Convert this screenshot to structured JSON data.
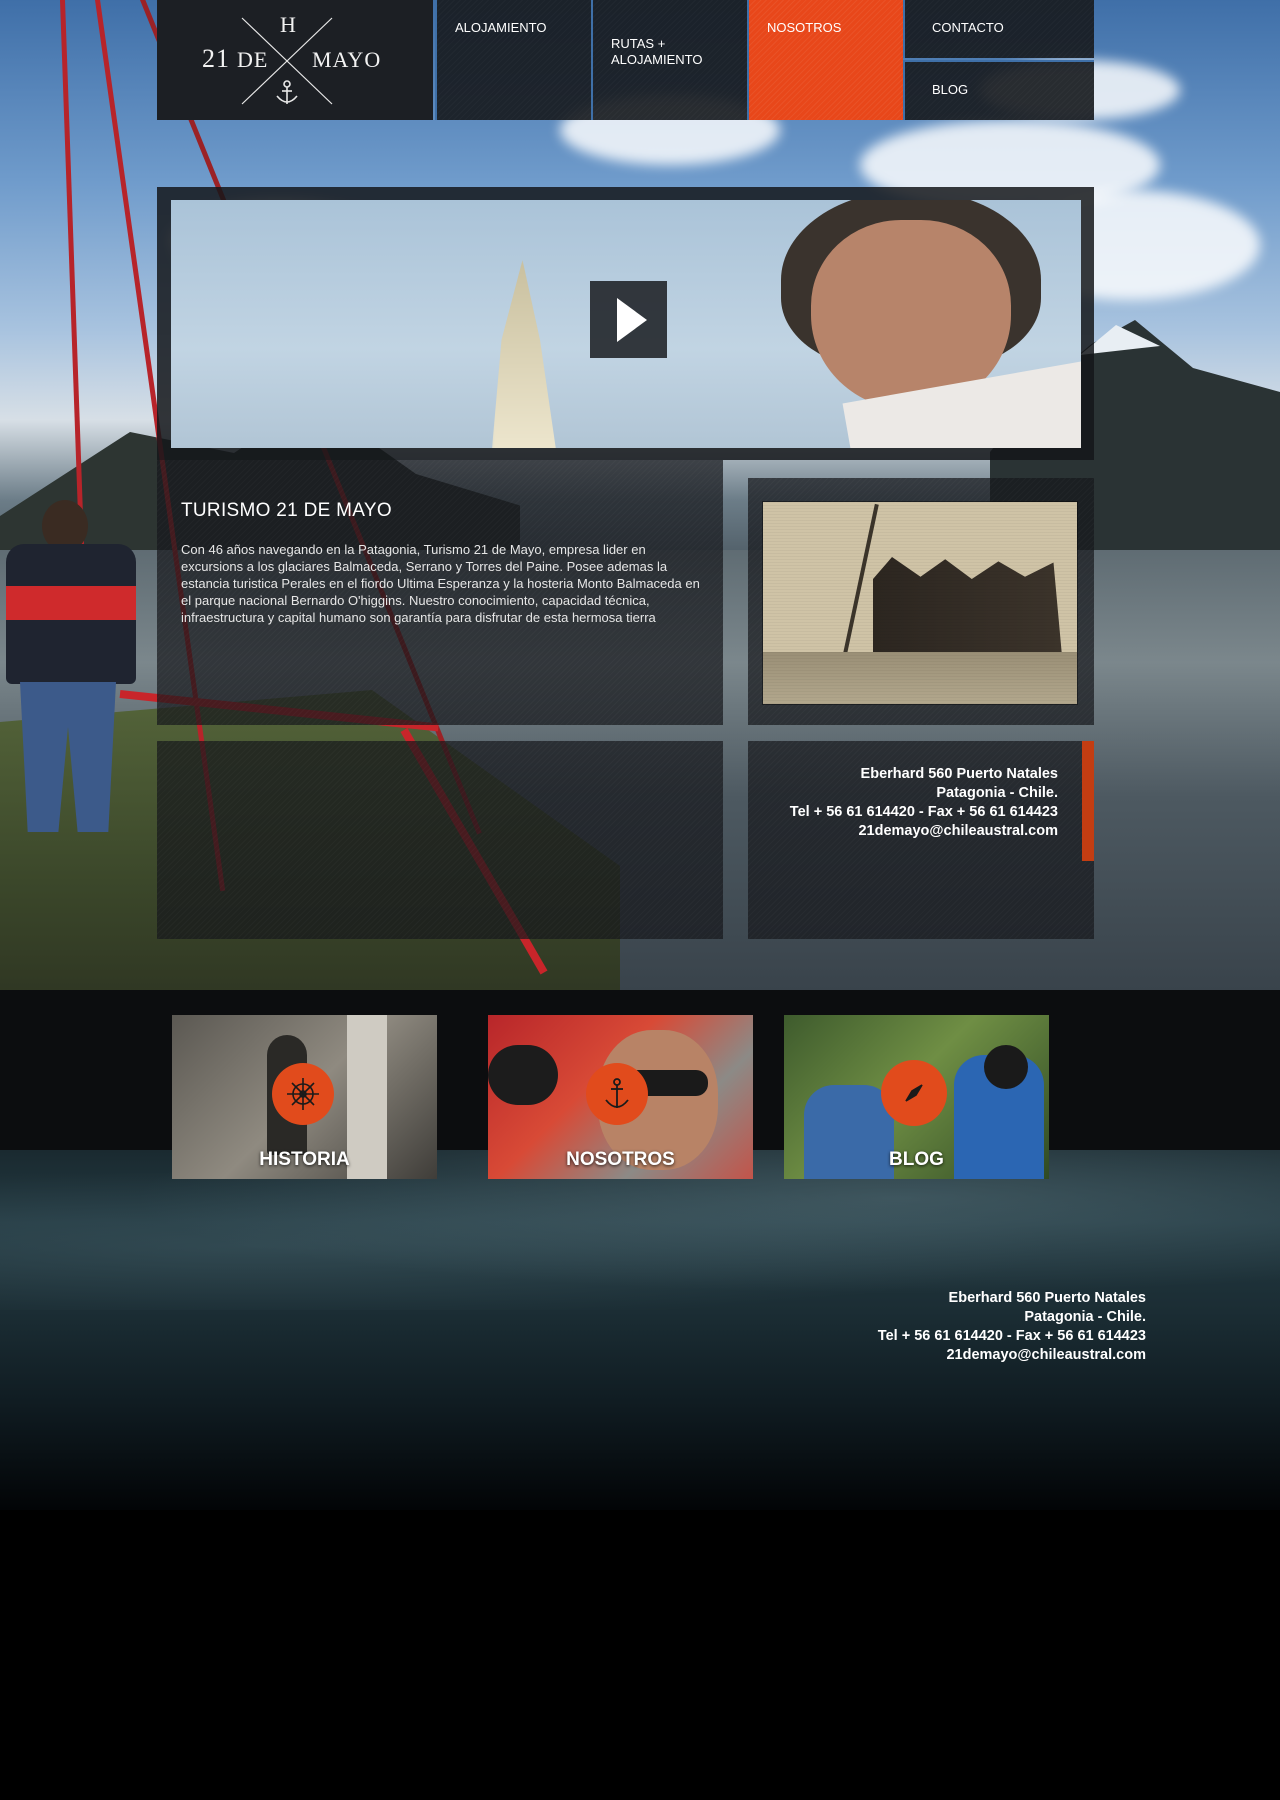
{
  "logo": {
    "letter_top": "H",
    "left": "21",
    "middle": "DE",
    "right": "MAYO"
  },
  "nav": {
    "items": [
      {
        "label": "ALOJAMIENTO"
      },
      {
        "label": "RUTAS +\nALOJAMIENTO"
      },
      {
        "label": "NOSOTROS"
      },
      {
        "label": "CONTACTO"
      },
      {
        "label": "BLOG"
      }
    ],
    "active": "NOSOTROS"
  },
  "video": {
    "play_icon": "play-icon"
  },
  "about": {
    "title": "TURISMO 21 DE MAYO",
    "body": "Con 46 años navegando en la Patagonia, Turismo 21 de Mayo, empresa lider en excursions a los glaciares Balmaceda, Serrano y Torres del Paine. Posee ademas la estancia turistica Perales en el fiordo Ultima Esperanza y la hosteria Monto Balmaceda en el parque nacional Bernardo O'higgins. Nuestro conocimiento, capacidad técnica, infraestructura y capital humano son garantía para disfrutar de esta hermosa tierra"
  },
  "contact": {
    "line1": "Eberhard 560 Puerto Natales",
    "line2": "Patagonia - Chile.",
    "line3": "Tel + 56 61 614420 - Fax + 56 61 614423",
    "line4": "21demayo@chileaustral.com"
  },
  "tiles": [
    {
      "label": "HISTORIA",
      "icon": "ship-wheel-icon"
    },
    {
      "label": "NOSOTROS",
      "icon": "anchor-icon"
    },
    {
      "label": "BLOG",
      "icon": "compass-icon"
    }
  ],
  "footer": {
    "line1": "Eberhard 560 Puerto Natales",
    "line2": "Patagonia - Chile.",
    "line3": "Tel + 56 61 614420 - Fax + 56 61 614423",
    "line4": "21demayo@chileaustral.com"
  },
  "colors": {
    "accent": "#e8471a",
    "nav_border": "#3f70a8",
    "panel": "#16181c"
  }
}
